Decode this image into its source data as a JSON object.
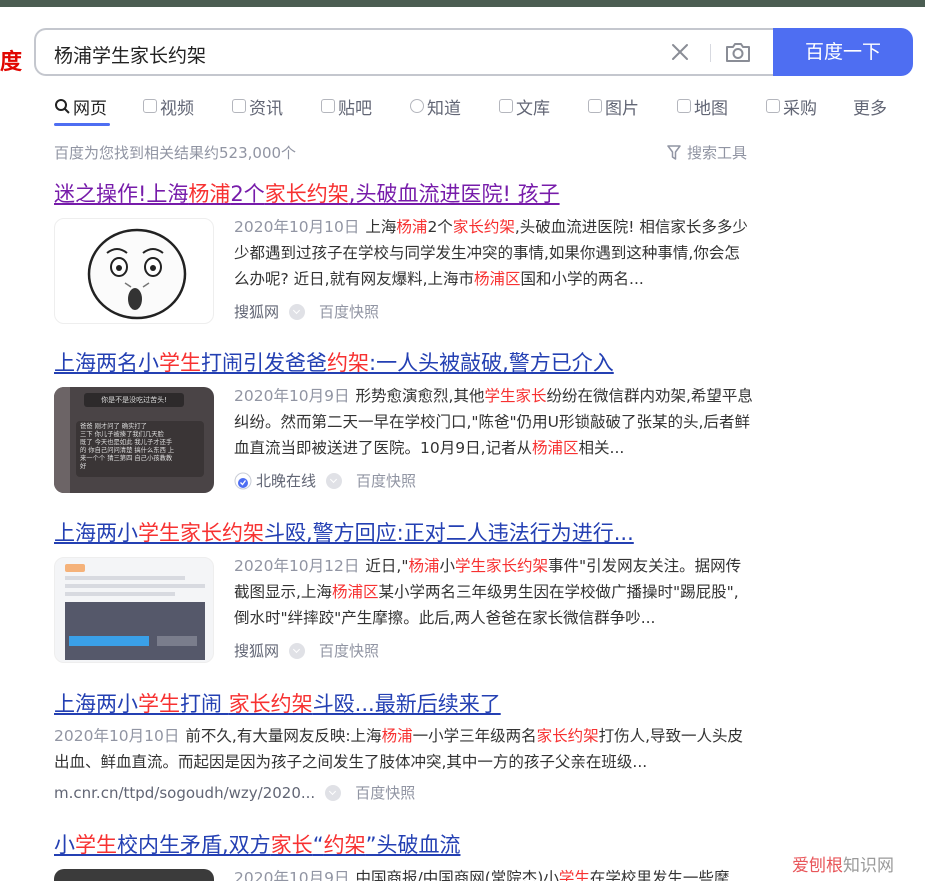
{
  "logo": {
    "text": "度"
  },
  "search": {
    "query": "杨浦学生家长约架",
    "button_label": "百度一下"
  },
  "tabs": [
    {
      "label": "网页",
      "active": true,
      "icon": "search-icon"
    },
    {
      "label": "视频",
      "icon": "video-icon"
    },
    {
      "label": "资讯",
      "icon": "news-icon"
    },
    {
      "label": "贴吧",
      "icon": "tieba-icon"
    },
    {
      "label": "知道",
      "icon": "question-icon"
    },
    {
      "label": "文库",
      "icon": "doc-icon"
    },
    {
      "label": "图片",
      "icon": "image-icon"
    },
    {
      "label": "地图",
      "icon": "map-icon"
    },
    {
      "label": "采购",
      "icon": "cart-icon"
    },
    {
      "label": "更多"
    }
  ],
  "result_count": "百度为您找到相关结果约523,000个",
  "search_tools": "搜索工具",
  "results": [
    {
      "title_parts": [
        "迷之操作!上海",
        "杨浦",
        "2个",
        "家长约架",
        ",头破血流进医院! 孩子"
      ],
      "date": "2020年10月10日",
      "body_parts": [
        "上海",
        "杨浦",
        "2个",
        "家长约架",
        ",头破血流进医院! 相信家长多多少少都遇到过孩子在学校与同学发生冲突的事情,如果你遇到这种事情,你会怎么办呢? 近日,就有网友爆料,上海市",
        "杨浦区",
        "国和小学的两名..."
      ],
      "source": "搜狐网",
      "snapshot": "百度快照"
    },
    {
      "title_parts": [
        "上海两名小",
        "学生",
        "打闹引发爸爸",
        "约架",
        ":一人头被敲破,警方已介入"
      ],
      "date": "2020年10月9日",
      "body_parts": [
        "形势愈演愈烈,其他",
        "学生家长",
        "纷纷在微信群内劝架,希望平息纠纷。然而第二天一早在学校门口,\"陈爸\"仍用U形锁敲破了张某的头,后者鲜血直流当即被送进了医院。10月9日,记者从",
        "杨浦区",
        "相关..."
      ],
      "source": "北晚在线",
      "snapshot": "百度快照",
      "thumb_text": [
        "你是不是没吃过苦头!",
        "爸爸 刚才问了 确实打了",
        "三下 你儿子被揍了我们几天脸",
        "既了 今天也是如此 我儿子才还手",
        "的 你自己问问清楚 搞什么东西 上",
        "来一个个 猜三第四 自己小孩教教",
        "好"
      ]
    },
    {
      "title_parts": [
        "上海两小",
        "学生家长约架",
        "斗殴,警方回应:正对二人违法行为进行..."
      ],
      "date": "2020年10月12日",
      "body_parts": [
        "近日,\"",
        "杨浦",
        "小",
        "学生家长约架",
        "事件\"引发网友关注。据网传截图显示,上海",
        "杨浦区",
        "某小学两名三年级男生因在学校做广播操时\"踢屁股\",倒水时\"绊摔跤\"产生摩擦。此后,两人爸爸在家长微信群争吵..."
      ],
      "source": "搜狐网",
      "snapshot": "百度快照"
    },
    {
      "title_parts": [
        "上海两小",
        "学生",
        "打闹 ",
        "家长约架",
        "斗殴...最新后续来了"
      ],
      "date": "2020年10月10日",
      "body_parts": [
        "前不久,有大量网友反映:上海",
        "杨浦",
        "一小学三年级两名",
        "家长约架",
        "打伤人,导致一人头皮出血、鲜血直流。而起因是因为孩子之间发生了肢体冲突,其中一方的孩子父亲在班级..."
      ],
      "source": "m.cnr.cn/ttpd/sogoudh/wzy/2020...",
      "snapshot": "百度快照"
    },
    {
      "title_parts": [
        "小",
        "学生",
        "校内生矛盾,双方",
        "家长",
        "“",
        "约架",
        "”头破血流"
      ],
      "date": "2020年10月9日",
      "body_parts": [
        "中国商报/中国商网(常院杰)小",
        "学生",
        "在学校里发生一些摩"
      ]
    }
  ],
  "watermark": {
    "brand": "爱刨根",
    "suffix": "知识网"
  },
  "colors": {
    "accent": "#4e6ef2",
    "link": "#2440b3",
    "visited": "#771caa",
    "highlight": "#f73131"
  }
}
